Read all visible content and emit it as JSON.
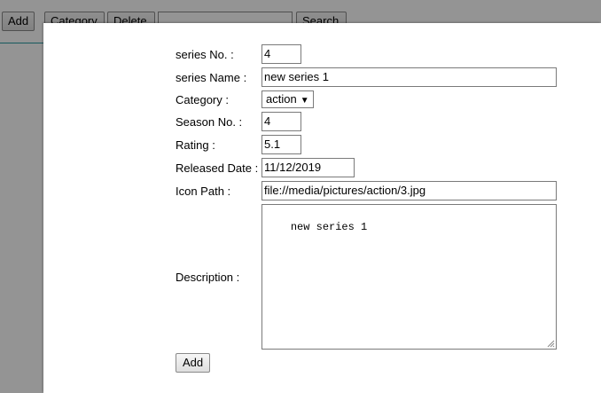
{
  "toolbar": {
    "add_label": "Add",
    "category_label": "Category",
    "delete_label": "Delete",
    "search_value": "",
    "search_label": "Search"
  },
  "dialog": {
    "series_no": {
      "label": "series No. :",
      "value": "4"
    },
    "series_name": {
      "label": "series Name :",
      "value": "new series 1"
    },
    "category": {
      "label": "Category :",
      "value": "action"
    },
    "season_no": {
      "label": "Season No. :",
      "value": "4"
    },
    "rating": {
      "label": "Rating :",
      "value": "5.1"
    },
    "released_date": {
      "label": "Released Date :",
      "value": "11/12/2019"
    },
    "icon_path": {
      "label": "Icon Path :",
      "value": "file://media/pictures/action/3.jpg"
    },
    "description": {
      "label": "Description :",
      "value": "new series 1"
    },
    "submit_label": "Add"
  },
  "colors": {
    "overlay": "rgba(0,0,0,0.42)",
    "toolbar_border": "#2a9aa3"
  }
}
